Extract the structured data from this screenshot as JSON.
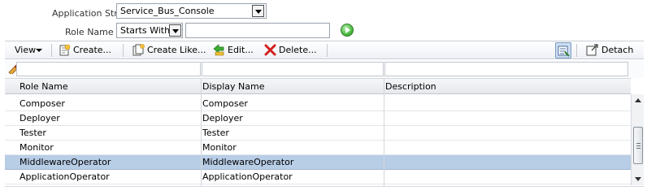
{
  "form": {
    "stripe_label": "Application Stripe",
    "stripe_value": "Service_Bus_Console",
    "role_label": "Role Name",
    "match_value": "Starts With",
    "role_value": ""
  },
  "toolbar": {
    "view_label": "View",
    "create_label": "Create...",
    "create_like_label": "Create Like...",
    "edit_label": "Edit...",
    "delete_label": "Delete...",
    "detach_label": "Detach"
  },
  "table": {
    "headers": [
      "Role Name",
      "Display Name",
      "Description"
    ],
    "rows": [
      {
        "role": "Composer",
        "display": "Composer",
        "desc": ""
      },
      {
        "role": "Deployer",
        "display": "Deployer",
        "desc": ""
      },
      {
        "role": "Tester",
        "display": "Tester",
        "desc": ""
      },
      {
        "role": "Monitor",
        "display": "Monitor",
        "desc": ""
      },
      {
        "role": "MiddlewareOperator",
        "display": "MiddlewareOperator",
        "desc": ""
      },
      {
        "role": "ApplicationOperator",
        "display": "ApplicationOperator",
        "desc": ""
      }
    ],
    "selected_index": 4
  },
  "colors": {
    "selected_row": "#b8cde6",
    "go_button": "#4cbb42",
    "delete_icon": "#d32020",
    "edit_icon": "#2e9a2a"
  }
}
